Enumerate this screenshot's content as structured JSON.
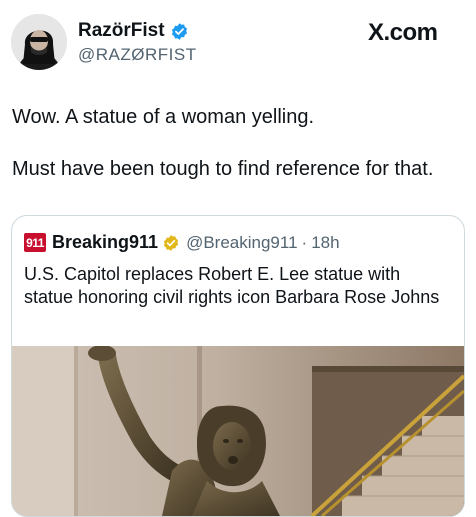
{
  "author": {
    "display_name": "RazörFist",
    "handle": "@RAZØRFIST",
    "verified_badge": "blue-check-icon"
  },
  "brand": {
    "label": "X.com"
  },
  "tweet": {
    "line1": "Wow. A statue of a woman yelling.",
    "line2": "Must have been tough to find reference for that."
  },
  "quoted_tweet": {
    "logo_text": "911",
    "display_name": "Breaking911",
    "handle": "@Breaking911",
    "separator": "·",
    "time": "18h",
    "verified_badge": "gold-check-icon",
    "text": "U.S. Capitol replaces Robert E. Lee statue with statue honoring civil rights icon Barbara Rose Johns"
  },
  "colors": {
    "text": "#0f1419",
    "secondary": "#536471",
    "verified_blue": "#1d9bf0",
    "verified_gold": "#e2b719",
    "logo_red": "#c8102e"
  }
}
